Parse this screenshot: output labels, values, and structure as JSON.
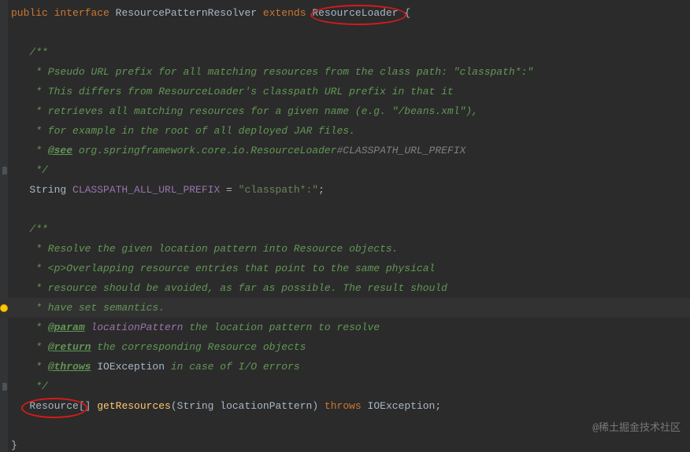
{
  "code": {
    "l0": {
      "kw_public": "public",
      "kw_interface": "interface",
      "name": "ResourcePatternResolver",
      "kw_extends": "extends",
      "parent": "ResourceLoader",
      "brace": " {"
    },
    "c1_0": "/**",
    "c1_1": " * Pseudo URL prefix for all matching resources from the class path: \"classpath*:\"",
    "c1_2": " * This differs from ResourceLoader's classpath URL prefix in that it",
    "c1_3": " * retrieves all matching resources for a given name (e.g. \"/beans.xml\"),",
    "c1_4": " * for example in the root of all deployed JAR files.",
    "c1_5": {
      "pre": " * ",
      "tag": "@see",
      "pkg": " org.springframework.core.io.ResourceLoader",
      "ref": "#CLASSPATH_URL_PREFIX"
    },
    "c1_6": " */",
    "field": {
      "type": "String ",
      "name": "CLASSPATH_ALL_URL_PREFIX",
      "eq": " = ",
      "val": "\"classpath*:\"",
      "semi": ";"
    },
    "c2_0": "/**",
    "c2_1": " * Resolve the given location pattern into Resource objects.",
    "c2_2": " * <p>Overlapping resource entries that point to the same physical",
    "c2_3": " * resource should be avoided, as far as possible. The result should",
    "c2_4": " * have set semantics.",
    "c2_5": {
      "pre": " * ",
      "tag": "@param",
      "var": " locationPattern",
      "desc": " the location pattern to resolve"
    },
    "c2_6": {
      "pre": " * ",
      "tag": "@return",
      "desc": " the corresponding Resource objects"
    },
    "c2_7": {
      "pre": " * ",
      "tag": "@throws",
      "exc": " IOException",
      "desc": " in case of I/O errors"
    },
    "c2_8": " */",
    "method": {
      "ret": "Resource",
      "arr": "[] ",
      "name": "getResources",
      "lp": "(",
      "ptype": "String ",
      "pname": "locationPattern",
      "rp": ")",
      "kw_throws": " throws ",
      "exc": "IOException",
      "semi": ";"
    },
    "close": "}"
  },
  "watermark": "@稀土掘金技术社区"
}
